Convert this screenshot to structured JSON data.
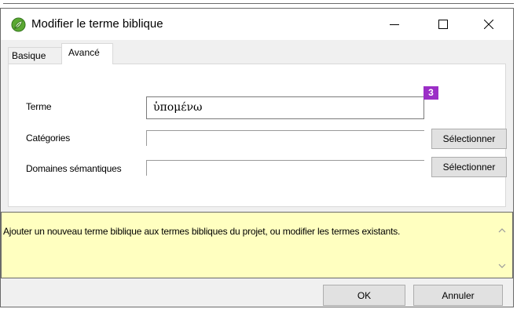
{
  "window": {
    "title": "Modifier le terme biblique",
    "controls": {
      "minimize": "minimize",
      "maximize": "maximize",
      "close": "close"
    }
  },
  "tabs": [
    {
      "label": "Basique",
      "active": false
    },
    {
      "label": "Avancé",
      "active": true
    }
  ],
  "form": {
    "terme": {
      "label": "Terme",
      "value": "ὑπομένω"
    },
    "categories": {
      "label": "Catégories",
      "value": "",
      "button": "Sélectionner"
    },
    "domaines": {
      "label": "Domaines sémantiques",
      "value": "",
      "button": "Sélectionner"
    },
    "badge": "3"
  },
  "help": {
    "text": "Ajouter un nouveau terme biblique aux termes bibliques du projet, ou modifier les termes existants."
  },
  "footer": {
    "ok": "OK",
    "cancel": "Annuler"
  },
  "colors": {
    "badge": "#9b2ec6",
    "help_bg": "#ffffc0",
    "dialog_bg": "#f0f0f0",
    "icon_green": "#5aa832"
  }
}
